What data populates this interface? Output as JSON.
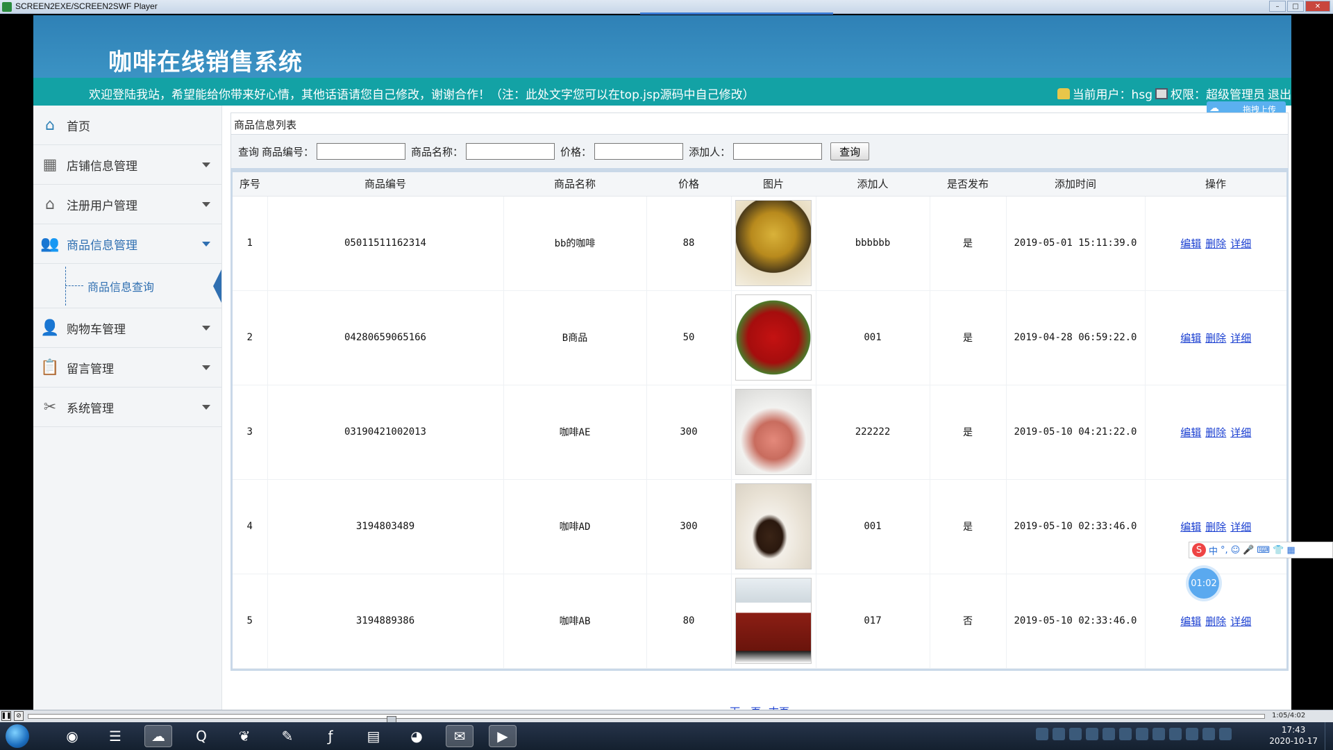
{
  "window": {
    "title": "SCREEN2EXE/SCREEN2SWF Player",
    "buttons": [
      "–",
      "□",
      "✕"
    ]
  },
  "header": {
    "system_title": "咖啡在线销售系统",
    "welcome_text": "欢迎登陆我站，希望能给你带来好心情，其他话语请您自己修改，谢谢合作！（注：此处文字您可以在top.jsp源码中自己修改）",
    "current_user": "当前用户：hsg",
    "permission": "权限：超级管理员",
    "logout": "退出",
    "drag_upload": "拖拽上传"
  },
  "sidebar": {
    "items": [
      {
        "label": "首页",
        "icon": "home-icon"
      },
      {
        "label": "店铺信息管理",
        "icon": "grid-icon"
      },
      {
        "label": "注册用户管理",
        "icon": "house-icon"
      },
      {
        "label": "商品信息管理",
        "icon": "users-icon"
      },
      {
        "label": "购物车管理",
        "icon": "person-icon"
      },
      {
        "label": "留言管理",
        "icon": "form-icon"
      },
      {
        "label": "系统管理",
        "icon": "tools-icon"
      }
    ],
    "sub_item": "商品信息查询"
  },
  "main": {
    "panel_title": "商品信息列表",
    "search": {
      "query_label": "查询",
      "code_label": "商品编号：",
      "name_label": "商品名称：",
      "price_label": "价格：",
      "adder_label": "添加人：",
      "button": "查询",
      "code_value": "",
      "name_value": "",
      "price_value": "",
      "adder_value": ""
    },
    "columns": [
      "序号",
      "商品编号",
      "商品名称",
      "价格",
      "图片",
      "添加人",
      "是否发布",
      "添加时间",
      "操作"
    ],
    "rows": [
      {
        "idx": "1",
        "code": "05011511162314",
        "name": "bb的咖啡",
        "price": "88",
        "adder": "bbbbbb",
        "published": "是",
        "time": "2019-05-01 15:11:39.0",
        "image": "yellow-flower-bouquet"
      },
      {
        "idx": "2",
        "code": "04280659065166",
        "name": "B商品",
        "price": "50",
        "adder": "001",
        "published": "是",
        "time": "2019-04-28 06:59:22.0",
        "image": "red-rose-heart"
      },
      {
        "idx": "3",
        "code": "03190421002013",
        "name": "咖啡AE",
        "price": "300",
        "adder": "222222",
        "published": "是",
        "time": "2019-05-10 04:21:22.0",
        "image": "pink-flower-bouquet"
      },
      {
        "idx": "4",
        "code": "3194803489",
        "name": "咖啡AD",
        "price": "300",
        "adder": "001",
        "published": "是",
        "time": "2019-05-10 02:33:46.0",
        "image": "coffee-cup"
      },
      {
        "idx": "5",
        "code": "3194889386",
        "name": "咖啡AB",
        "price": "80",
        "adder": "017",
        "published": "否",
        "time": "2019-05-10 02:33:46.0",
        "image": "coffee-grinder"
      }
    ],
    "ops": {
      "edit": "编辑",
      "delete": "删除",
      "detail": "详细"
    },
    "pager": {
      "next": "下一页",
      "last": "末页"
    }
  },
  "overlay": {
    "timer": "01:02",
    "ime_logo": "S",
    "ime_mode": "中"
  },
  "player": {
    "time": "1:05/4:02"
  },
  "taskbar": {
    "clock_time": "17:43",
    "clock_date": "2020-10-17"
  },
  "colors": {
    "header_blue": "#2f81b6",
    "welcome_teal": "#13a2a5",
    "link_blue": "#1a3fd1",
    "active_blue": "#2f6fb1"
  }
}
